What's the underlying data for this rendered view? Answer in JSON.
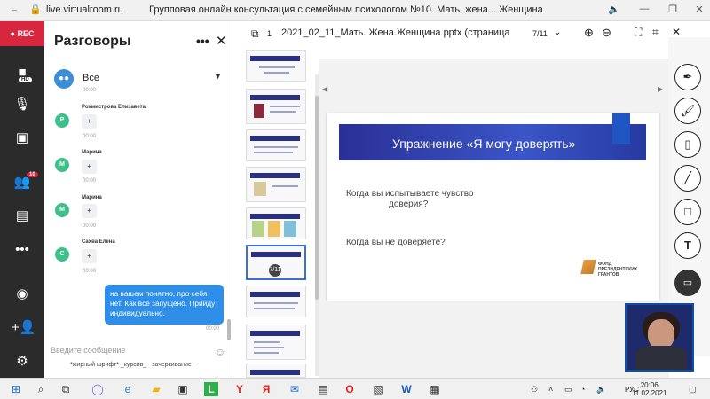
{
  "browser": {
    "url": "live.virtualroom.ru",
    "tab_title": "Групповая онлайн консультация с семейным психологом №10. Мать, жена... Женщина"
  },
  "rail": {
    "rec_label": "REC",
    "hd_badge": "HD",
    "participants_count": "10"
  },
  "chat": {
    "title": "Разговоры",
    "filter_label": "Все",
    "messages": [
      {
        "initial": "Р",
        "name": "Рохмистрова Елизавета",
        "text": "+",
        "time": "00:00"
      },
      {
        "initial": "М",
        "name": "Марина",
        "text": "+",
        "time": "00:00"
      },
      {
        "initial": "М",
        "name": "Марина",
        "text": "+",
        "time": "00:00"
      },
      {
        "initial": "С",
        "name": "Сахва Елена",
        "text": "+",
        "time": "00:00"
      }
    ],
    "top_time": "00:00",
    "my_message": "на вашем понятно, про себя нет. Как все запущено. Прийду индивидуально.",
    "my_time": "00:00",
    "input_placeholder": "Введите сообщение",
    "format_hints": "*жирный шрифт*    _курсив_    ~зачеркивание~"
  },
  "viewer": {
    "page_prefix": "1",
    "file_title": "2021_02_11_Мать. Жена.Женщина.pptx (страница",
    "page_counter": "7/11",
    "slide": {
      "title": "Упражнение «Я могу доверять»",
      "question1_line1": "Когда вы испытываете чувство",
      "question1_line2": "доверия?",
      "question2": "Когда вы не доверяете?",
      "fund_text": "ФОНД ПРЕЗИДЕНТСКИХ ГРАНТОВ"
    }
  },
  "taskbar": {
    "time": "20:06",
    "date": "11.02.2021",
    "lang": "РУС"
  }
}
